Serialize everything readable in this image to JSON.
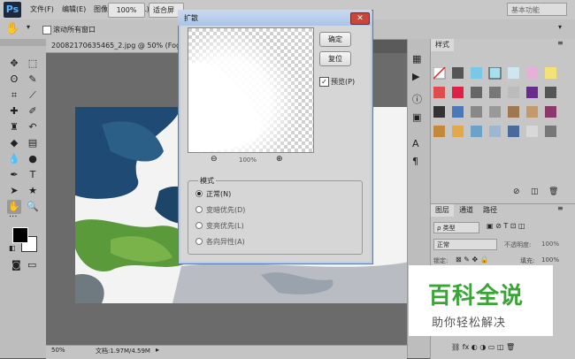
{
  "app": {
    "logo": "Ps"
  },
  "menu": {
    "items": [
      "文件(F)",
      "编辑(E)",
      "图像(I)",
      "图层(L)",
      "文字"
    ]
  },
  "options": {
    "scroll_all_windows": "滚动所有窗口",
    "zoom_value": "100%",
    "fit_screen": "适合屏"
  },
  "workspace": {
    "name": "基本功能"
  },
  "document": {
    "tab_title": "20082170635465_2.jpg @ 50% (Fog, R",
    "zoom": "50%",
    "doc_size": "文档:1.97M/4.59M"
  },
  "dialog": {
    "title": "扩散",
    "close_glyph": "✕",
    "ok_label": "确定",
    "reset_label": "复位",
    "preview_label": "预览(P)",
    "zoom_out": "⊖",
    "zoom_in": "⊕",
    "zoom_percent": "100%",
    "mode_title": "模式",
    "modes": [
      "正常(N)",
      "变暗优先(D)",
      "变亮优先(L)",
      "各向异性(A)"
    ],
    "selected_mode": 0
  },
  "styles_panel": {
    "tab": "样式"
  },
  "layers_panel": {
    "tabs": [
      "图层",
      "通道",
      "路径"
    ],
    "kind_label": "ρ 类型",
    "blend_mode": "正常",
    "opacity_label": "不透明度:",
    "opacity_value": "100%",
    "lock_label": "锁定:",
    "fill_label": "填充:",
    "fill_value": "100%"
  },
  "watermark": {
    "line1": "百科全说",
    "line2": "助你轻松解决"
  },
  "colors": {
    "accent": "#3aa437",
    "dialog_border": "#5a78a8",
    "close_red": "#c9463d"
  }
}
